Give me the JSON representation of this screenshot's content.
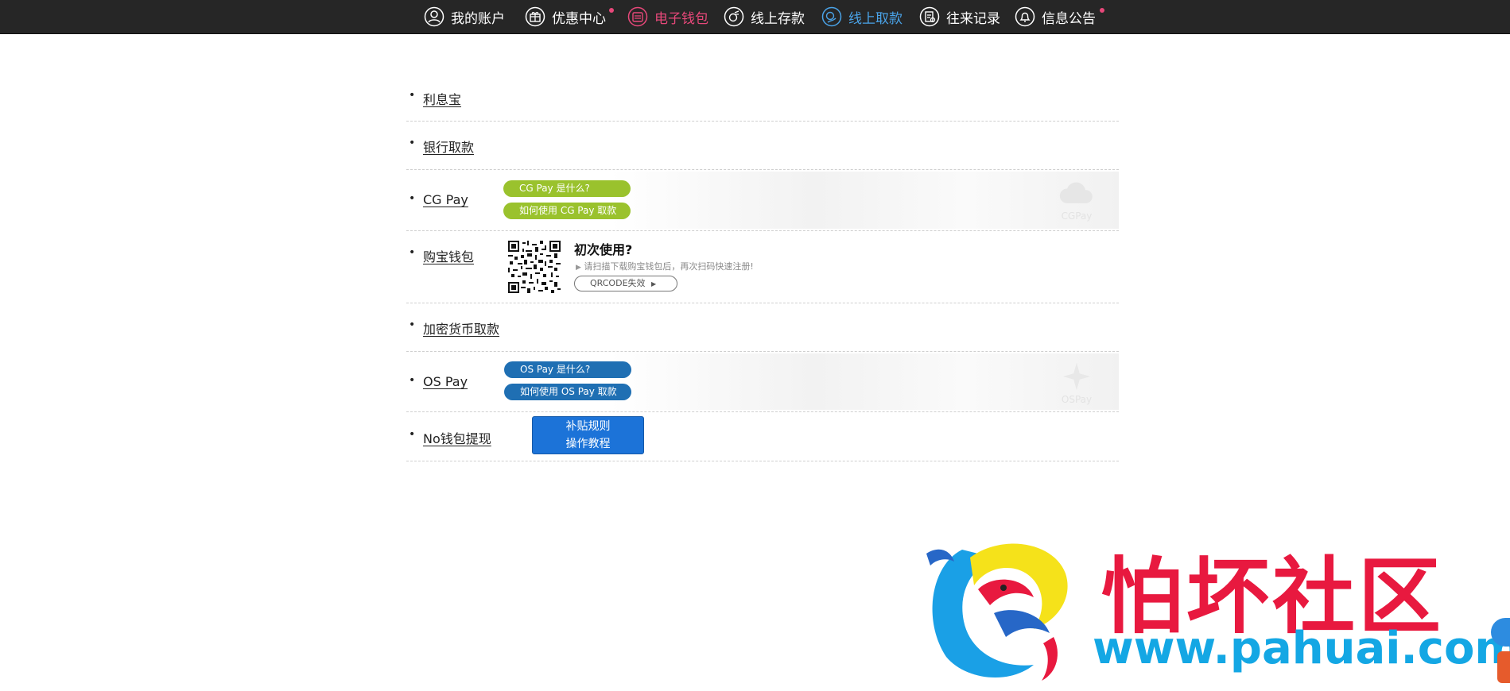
{
  "nav": {
    "items": [
      {
        "label": "我的账户",
        "icon": "user-icon"
      },
      {
        "label": "优惠中心",
        "icon": "gift-icon"
      },
      {
        "label": "电子钱包",
        "icon": "wallet-icon"
      },
      {
        "label": "线上存款",
        "icon": "deposit-icon"
      },
      {
        "label": "线上取款",
        "icon": "withdraw-icon"
      },
      {
        "label": "往来记录",
        "icon": "records-icon"
      },
      {
        "label": "信息公告",
        "icon": "bell-icon"
      }
    ],
    "active_color": "#e8487a",
    "current_color": "#4aa3e8"
  },
  "methods": {
    "lixibao": {
      "label": "利息宝"
    },
    "bank": {
      "label": "银行取款"
    },
    "cgpay": {
      "label": "CG Pay",
      "what_btn": "CG Pay 是什么?",
      "howto_btn": "如何使用 CG Pay 取款",
      "logo_text": "CGPay"
    },
    "goubao": {
      "label": "购宝钱包",
      "title": "初次使用?",
      "hint": "请扫描下载购宝钱包后，再次扫码快速注册!",
      "qr_btn": "QRCODE失效"
    },
    "crypto": {
      "label": "加密货币取款"
    },
    "ospay": {
      "label": "OS Pay",
      "what_btn": "OS Pay 是什么?",
      "howto_btn": "如何使用 OS Pay 取款",
      "logo_text": "OSPay"
    },
    "nowallet": {
      "label": "No钱包提现",
      "btn_line1": "补贴规则",
      "btn_line2": "操作教程"
    }
  },
  "watermark": {
    "title": "怕坏社区",
    "url": "www.pahuai.com"
  }
}
